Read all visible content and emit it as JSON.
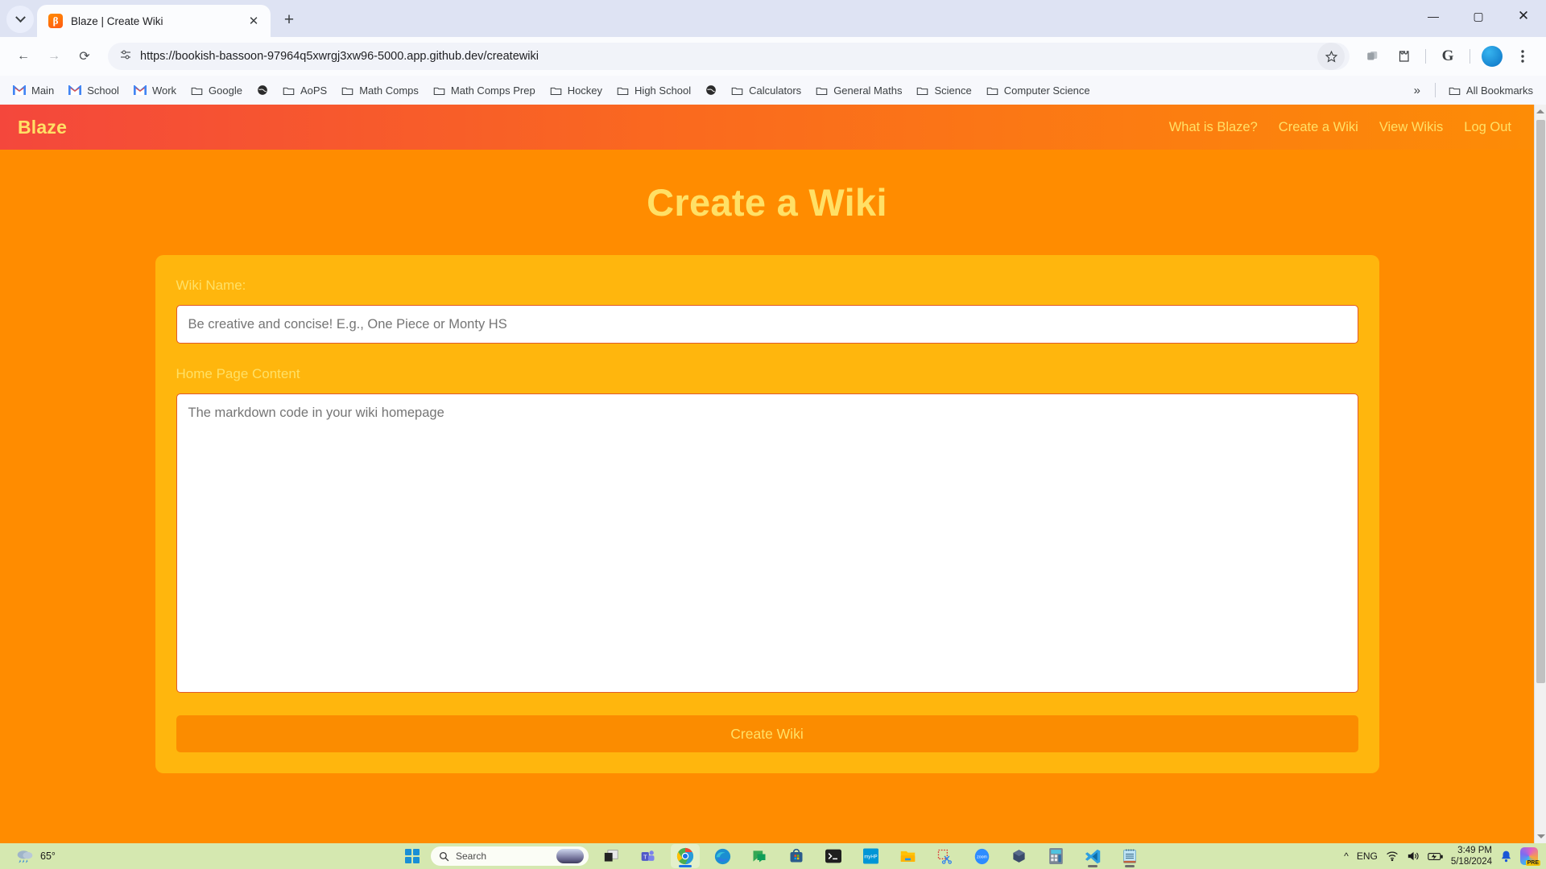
{
  "browser": {
    "tab": {
      "title": "Blaze | Create Wiki",
      "favicon_letter": "β",
      "favicon_name": "blaze-favicon"
    },
    "new_tab_label": "+",
    "window_controls": {
      "minimize": "—",
      "maximize": "▢",
      "close": "✕"
    },
    "nav": {
      "back": "←",
      "forward": "→",
      "reload": "⟳"
    },
    "omnibox": {
      "url": "https://bookish-bassoon-97964q5xwrgj3xw96-5000.app.github.dev/createwiki",
      "site_info_icon": "tune-icon",
      "bookmark_icon": "star-icon"
    },
    "toolbar_icons": [
      "tab-group-icon",
      "extensions-icon",
      "google-icon",
      "profile-avatar",
      "chrome-menu-icon"
    ],
    "bookmarks": [
      {
        "label": "Main",
        "icon": "gmail-icon"
      },
      {
        "label": "School",
        "icon": "gmail-icon"
      },
      {
        "label": "Work",
        "icon": "gmail-icon"
      },
      {
        "label": "Google",
        "icon": "folder-icon"
      },
      {
        "label": "",
        "icon": "globe-icon"
      },
      {
        "label": "AoPS",
        "icon": "folder-icon"
      },
      {
        "label": "Math Comps",
        "icon": "folder-icon"
      },
      {
        "label": "Math Comps Prep",
        "icon": "folder-icon"
      },
      {
        "label": "Hockey",
        "icon": "folder-icon"
      },
      {
        "label": "High School",
        "icon": "folder-icon"
      },
      {
        "label": "",
        "icon": "globe-icon"
      },
      {
        "label": "Calculators",
        "icon": "folder-icon"
      },
      {
        "label": "General Maths",
        "icon": "folder-icon"
      },
      {
        "label": "Science",
        "icon": "folder-icon"
      },
      {
        "label": "Computer Science",
        "icon": "folder-icon"
      }
    ],
    "bookmarks_overflow": "»",
    "all_bookmarks": "All Bookmarks"
  },
  "site": {
    "brand": "Blaze",
    "nav_links": [
      "What is Blaze?",
      "Create a Wiki",
      "View Wikis",
      "Log Out"
    ],
    "heading": "Create a Wiki",
    "form": {
      "name_label": "Wiki Name:",
      "name_placeholder": "Be creative and concise! E.g., One Piece or Monty HS",
      "name_value": "",
      "content_label": "Home Page Content",
      "content_placeholder": "The markdown code in your wiki homepage",
      "content_value": "",
      "submit_label": "Create Wiki"
    },
    "colors": {
      "page_background": "#ff8c00",
      "navbar_gradient_start": "#f4473c",
      "navbar_gradient_end": "#fd8c06",
      "card_background": "#ffb60d",
      "accent_text": "#ffe066",
      "button_background": "#fb8c00"
    }
  },
  "taskbar": {
    "weather_temp": "65°",
    "weather_icon": "rain-icon",
    "start_icon": "windows-start-icon",
    "search_placeholder": "Search",
    "apps": [
      {
        "name": "task-view",
        "running": false
      },
      {
        "name": "microsoft-teams",
        "running": false
      },
      {
        "name": "google-chrome",
        "running": true
      },
      {
        "name": "microsoft-edge",
        "running": false
      },
      {
        "name": "google-chat",
        "running": false
      },
      {
        "name": "microsoft-store",
        "running": false
      },
      {
        "name": "terminal",
        "running": false
      },
      {
        "name": "myhp",
        "running": false
      },
      {
        "name": "file-explorer",
        "running": false
      },
      {
        "name": "snipping-tool",
        "running": false
      },
      {
        "name": "zoom",
        "running": false
      },
      {
        "name": "virtualbox",
        "running": false
      },
      {
        "name": "calculator",
        "running": false
      },
      {
        "name": "visual-studio-code",
        "running": true
      },
      {
        "name": "notepad",
        "running": true
      }
    ],
    "tray": {
      "chevron": "^",
      "language": "ENG",
      "icons": [
        "wifi-icon",
        "volume-icon",
        "battery-icon"
      ],
      "time": "3:49 PM",
      "date": "5/18/2024",
      "notification_icon": "bell-icon",
      "copilot_badge": "PRE"
    }
  }
}
